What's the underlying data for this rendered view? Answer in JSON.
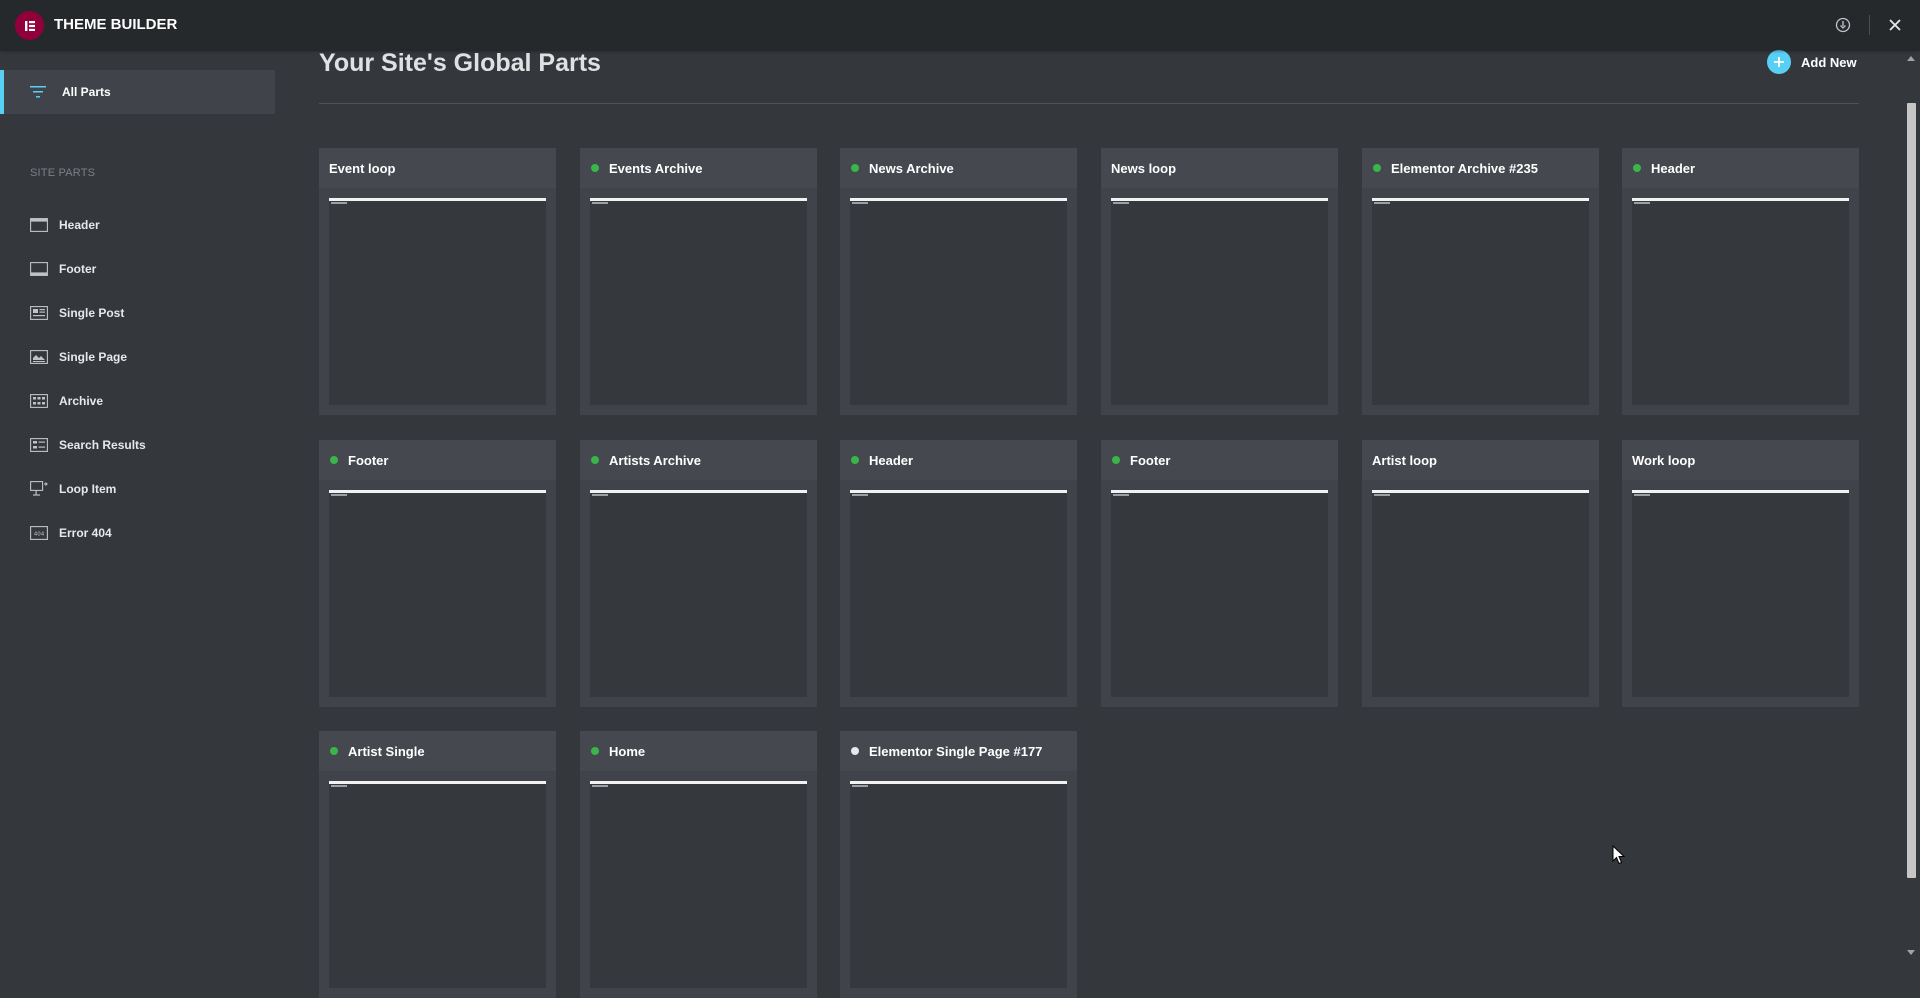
{
  "app": {
    "title": "THEME BUILDER"
  },
  "header_icons": [
    "info-icon",
    "close-icon"
  ],
  "sidebar": {
    "all_parts_label": "All Parts",
    "section_label": "SITE PARTS",
    "items": [
      {
        "label": "Header",
        "icon": "header-icon"
      },
      {
        "label": "Footer",
        "icon": "footer-icon"
      },
      {
        "label": "Single Post",
        "icon": "single-post-icon"
      },
      {
        "label": "Single Page",
        "icon": "single-page-icon"
      },
      {
        "label": "Archive",
        "icon": "archive-icon"
      },
      {
        "label": "Search Results",
        "icon": "search-results-icon"
      },
      {
        "label": "Loop Item",
        "icon": "loop-item-icon"
      },
      {
        "label": "Error 404",
        "icon": "error-404-icon"
      }
    ]
  },
  "main": {
    "title": "Your Site's Global Parts",
    "add_new_label": "Add New",
    "cards": [
      {
        "name": "Event loop",
        "status": "none"
      },
      {
        "name": "Events Archive",
        "status": "active"
      },
      {
        "name": "News Archive",
        "status": "active"
      },
      {
        "name": "News loop",
        "status": "none"
      },
      {
        "name": "Elementor Archive #235",
        "status": "active"
      },
      {
        "name": "Header",
        "status": "active"
      },
      {
        "name": "Footer",
        "status": "active"
      },
      {
        "name": "Artists Archive",
        "status": "active"
      },
      {
        "name": "Header",
        "status": "active"
      },
      {
        "name": "Footer",
        "status": "active"
      },
      {
        "name": "Artist loop",
        "status": "none"
      },
      {
        "name": "Work loop",
        "status": "none"
      },
      {
        "name": "Artist Single",
        "status": "active"
      },
      {
        "name": "Home",
        "status": "active"
      },
      {
        "name": "Elementor Single Page #177",
        "status": "inactive"
      }
    ]
  },
  "colors": {
    "accent": "#58d0f5",
    "brand": "#92003b",
    "active_dot": "#39b54a",
    "inactive_dot": "#e6e8ea"
  }
}
